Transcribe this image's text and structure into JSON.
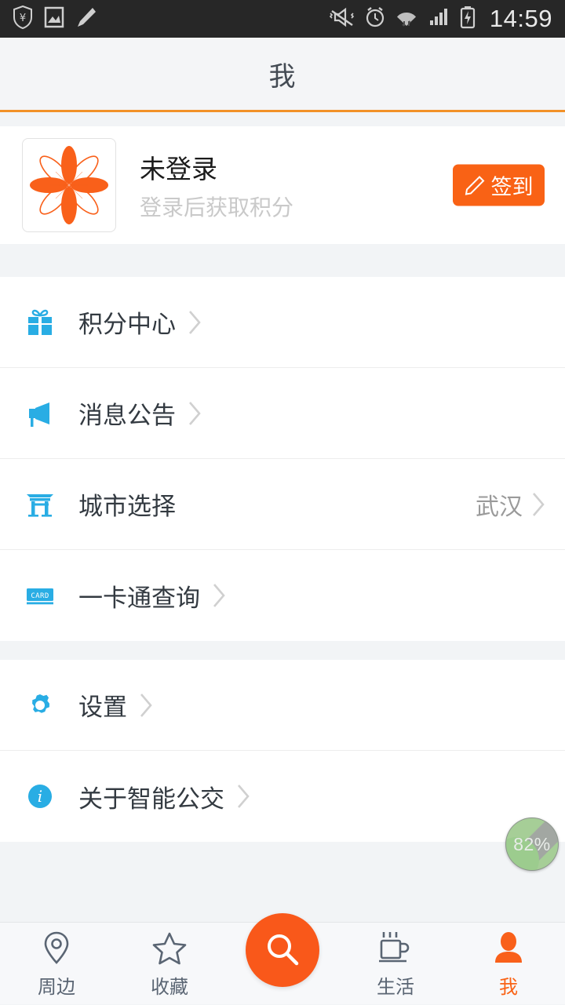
{
  "statusbar": {
    "time": "14:59",
    "left_icons": [
      "shield-yuan-icon",
      "photo-icon",
      "pencil-icon"
    ],
    "right_icons": [
      "vibrate-mute-icon",
      "alarm-clock-icon",
      "wifi-icon",
      "signal-icon",
      "battery-charging-icon"
    ]
  },
  "header": {
    "title": "我",
    "accent_color": "#f29128"
  },
  "profile": {
    "avatar_icon": "flower-logo",
    "name": "未登录",
    "subtitle": "登录后获取积分",
    "sign_button": {
      "label": "签到",
      "icon": "pencil-icon",
      "color": "#f96215"
    }
  },
  "menu_groups": [
    {
      "items": [
        {
          "icon": "gift-icon",
          "label": "积分中心",
          "value": ""
        },
        {
          "icon": "megaphone-icon",
          "label": "消息公告",
          "value": ""
        },
        {
          "icon": "torii-gate-icon",
          "label": "城市选择",
          "value": "武汉"
        },
        {
          "icon": "card-icon",
          "label": "一卡通查询",
          "value": ""
        }
      ]
    },
    {
      "items": [
        {
          "icon": "gear-icon",
          "label": "设置",
          "value": ""
        },
        {
          "icon": "info-icon",
          "label": "关于智能公交",
          "value": ""
        }
      ]
    }
  ],
  "memory_widget": {
    "percent": "82%"
  },
  "tabbar": {
    "items": [
      {
        "icon": "location-pin-icon",
        "label": "周边",
        "active": false
      },
      {
        "icon": "star-icon",
        "label": "收藏",
        "active": false
      },
      {
        "icon": "coffee-cup-icon",
        "label": "生活",
        "active": false
      },
      {
        "icon": "person-icon",
        "label": "我",
        "active": true
      }
    ],
    "fab": {
      "icon": "search-icon",
      "color": "#f9581a"
    }
  },
  "colors": {
    "blue_icon": "#29ade4",
    "orange": "#f96215",
    "page_bg": "#f2f4f6"
  }
}
